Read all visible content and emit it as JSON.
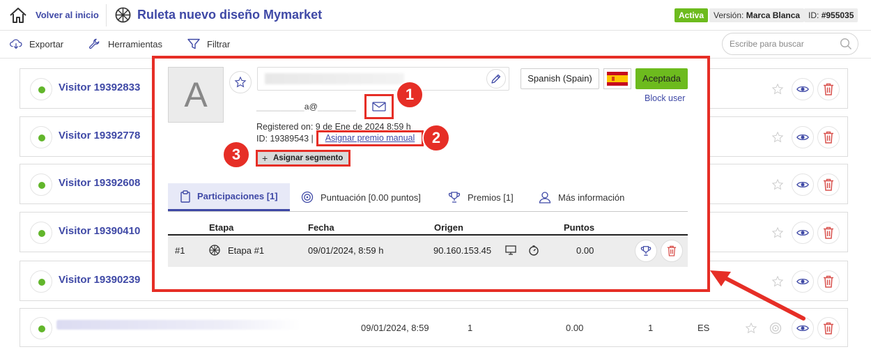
{
  "header": {
    "back_label": "Volver al inicio",
    "title": "Ruleta nuevo diseño Mymarket",
    "status_badge": "Activa",
    "version_label": "Versión:",
    "version_value": "Marca Blanca",
    "id_label": "ID:",
    "id_value": "#955035"
  },
  "toolbar": {
    "export_label": "Exportar",
    "tools_label": "Herramientas",
    "filter_label": "Filtrar",
    "search_placeholder": "Escribe para buscar"
  },
  "visitors": [
    {
      "name": "Visitor 19392833"
    },
    {
      "name": "Visitor 19392778"
    },
    {
      "name": "Visitor 19392608"
    },
    {
      "name": "Visitor 19390410"
    },
    {
      "name": "Visitor 19390239"
    }
  ],
  "last_row": {
    "date": "09/01/2024, 8:59",
    "participations": "1",
    "points": "0.00",
    "prizes": "1",
    "language": "ES"
  },
  "modal": {
    "avatar_letter": "A",
    "email_fragment": "a@",
    "registered_text": "Registered on: 9 de Ene de 2024 8:59 h",
    "id_text": "ID: 19389543 |",
    "assign_prize_label": "Asignar premio manual",
    "assign_segment_label": "Asignar segmento",
    "plus": "+",
    "language_button": "Spanish (Spain)",
    "accept_button": "Aceptada",
    "block_user_label": "Block user",
    "tabs": [
      {
        "label": "Participaciones [1]"
      },
      {
        "label": "Puntuación [0.00 puntos]"
      },
      {
        "label": "Premios [1]"
      },
      {
        "label": "Más información"
      }
    ],
    "table": {
      "headers": [
        "Etapa",
        "Fecha",
        "Origen",
        "Puntos"
      ],
      "rows": [
        {
          "index": "#1",
          "stage": "Etapa #1",
          "date": "09/01/2024, 8:59 h",
          "origin": "90.160.153.45",
          "points": "0.00"
        }
      ]
    }
  },
  "annotations": {
    "badge_1": "1",
    "badge_2": "2",
    "badge_3": "3",
    "highlight_color": "#e62e26"
  },
  "colors": {
    "primary": "#3f49a6",
    "success": "#6dbb1e",
    "danger": "#d9534f"
  }
}
